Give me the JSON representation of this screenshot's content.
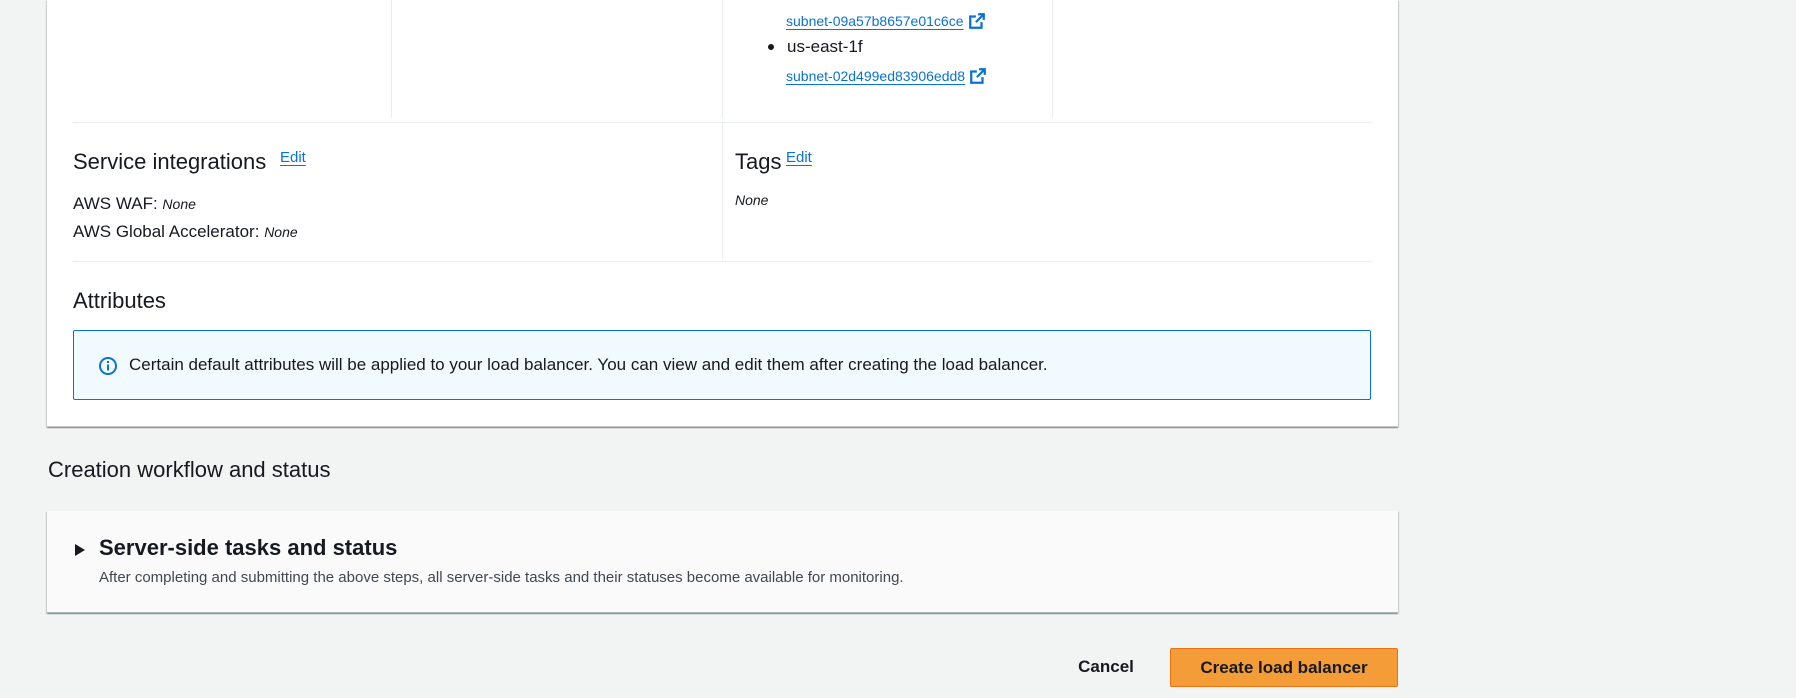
{
  "network": {
    "subnets": [
      {
        "subnet_id": "subnet-09a57b8657e01c6ce"
      },
      {
        "az": "us-east-1f",
        "subnet_id": "subnet-02d499ed83906edd8"
      }
    ]
  },
  "service_integrations": {
    "title": "Service integrations",
    "edit_label": "Edit",
    "waf_label": "AWS WAF:",
    "waf_value": "None",
    "ga_label": "AWS Global Accelerator:",
    "ga_value": "None"
  },
  "tags": {
    "title": "Tags",
    "edit_label": "Edit",
    "value": "None"
  },
  "attributes": {
    "title": "Attributes",
    "info_text": "Certain default attributes will be applied to your load balancer. You can view and edit them after creating the load balancer."
  },
  "workflow": {
    "heading": "Creation workflow and status",
    "section_title": "Server-side tasks and status",
    "section_desc": "After completing and submitting the above steps, all server-side tasks and their statuses become available for monitoring."
  },
  "actions": {
    "cancel_label": "Cancel",
    "create_label": "Create load balancer"
  },
  "colors": {
    "link": "#0972d3",
    "primary_button": "#f39c38",
    "info_bg": "#f1faff"
  },
  "icons": {
    "external_link": "external-link-icon",
    "info": "info-icon",
    "caret": "caret-right-icon"
  }
}
